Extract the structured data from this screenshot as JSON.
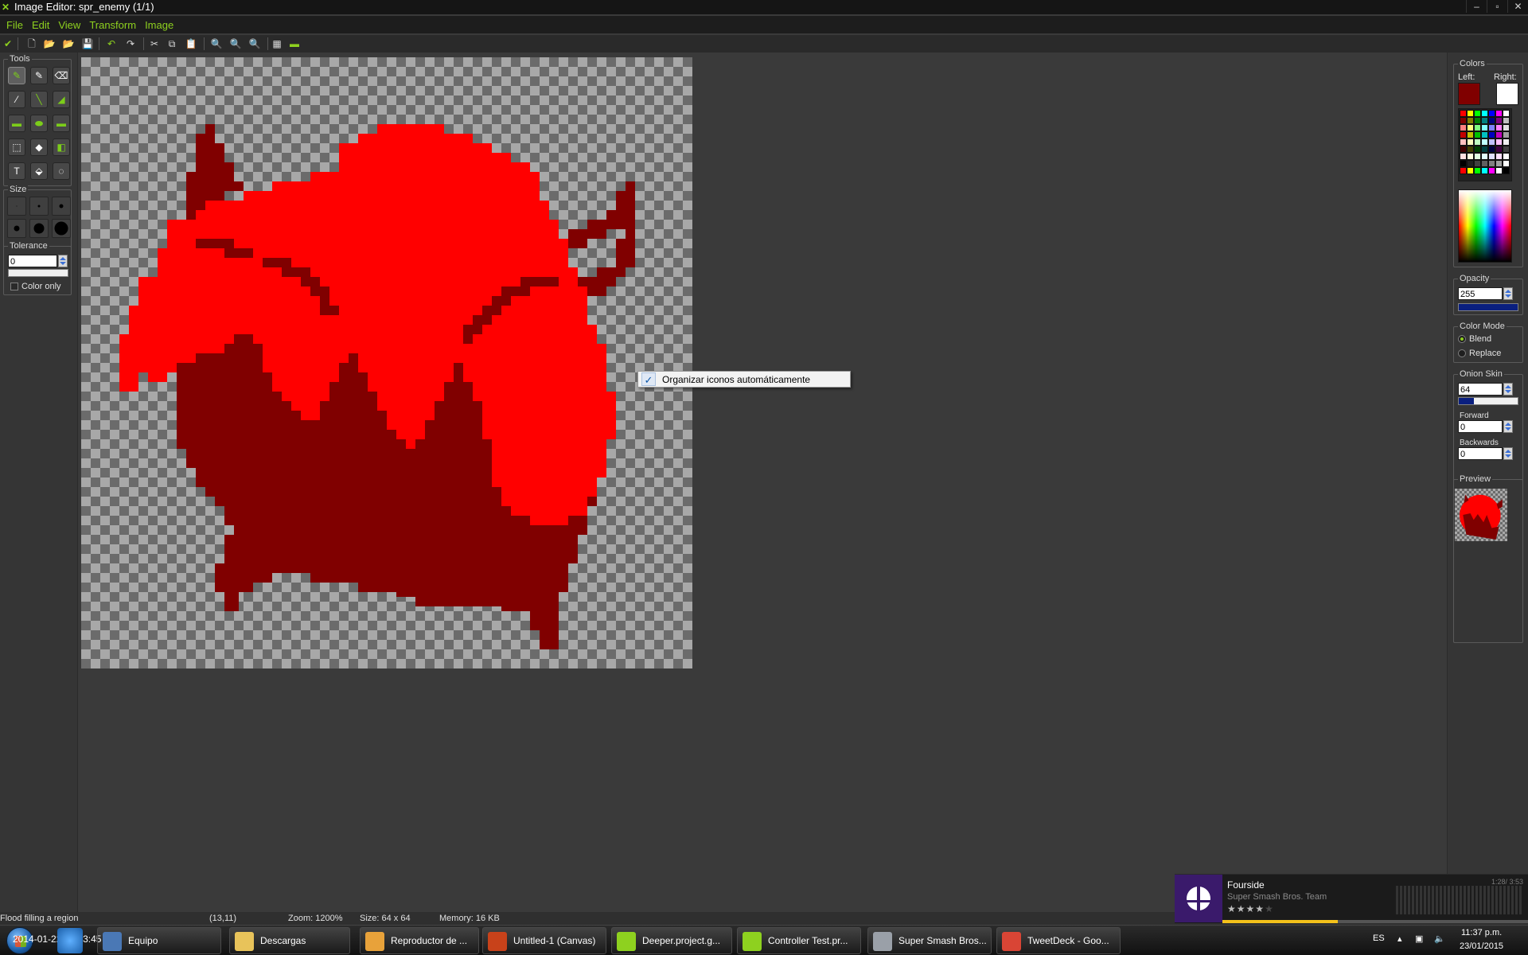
{
  "window": {
    "title": "Image Editor: spr_enemy (1/1)",
    "controls": [
      "–",
      "▫",
      "✕"
    ]
  },
  "menu": [
    "File",
    "Edit",
    "View",
    "Transform",
    "Image"
  ],
  "toolbar": {
    "icons": [
      "confirm-icon",
      "new-file-icon",
      "open-icon",
      "import-icon",
      "save-icon",
      "undo-icon",
      "redo-icon",
      "cut-icon",
      "copy-icon",
      "paste-icon",
      "zoom-out-icon",
      "zoom-reset-icon",
      "zoom-in-icon",
      "grid-icon",
      "preview-toggle-icon"
    ]
  },
  "tools_panel": {
    "tools_title": "Tools",
    "size_title": "Size",
    "tolerance_title": "Tolerance",
    "tolerance_value": "0",
    "color_only_label": "Color only"
  },
  "canvas": {
    "background_dark": "#6b6b6b",
    "background_light": "#a8a8a8",
    "colors": {
      "bright_red": "#ff0000",
      "dark_red": "#800000"
    }
  },
  "context_menu": {
    "item_label": "Organizar iconos automáticamente",
    "checked": true
  },
  "colors_panel": {
    "title": "Colors",
    "left_label": "Left:",
    "right_label": "Right:",
    "left_color": "#800000",
    "right_color": "#ffffff",
    "palette": [
      "#ff0000",
      "#ffff00",
      "#00ff00",
      "#00ffff",
      "#0000ff",
      "#ff00ff",
      "#ffffff",
      "#800000",
      "#808000",
      "#008000",
      "#008080",
      "#000080",
      "#800080",
      "#c0c0c0",
      "#ff8080",
      "#ffff80",
      "#80ff80",
      "#80ffff",
      "#8080ff",
      "#ff80ff",
      "#e0e0e0",
      "#c00000",
      "#c0c000",
      "#00c000",
      "#00c0c0",
      "#0000c0",
      "#c000c0",
      "#a0a0a0",
      "#ffc0c0",
      "#ffffc0",
      "#c0ffc0",
      "#c0ffff",
      "#c0c0ff",
      "#ffc0ff",
      "#f0f0f0",
      "#400000",
      "#404000",
      "#004000",
      "#004040",
      "#000040",
      "#400040",
      "#404040",
      "#ffe0e0",
      "#ffffe0",
      "#e0ffe0",
      "#e0ffff",
      "#e0e0ff",
      "#ffe0ff",
      "#ffffff",
      "#000000",
      "#202020",
      "#404040",
      "#606060",
      "#808080",
      "#a0a0a0",
      "#ffffff",
      "#ff0000",
      "#ffff00",
      "#00ff00",
      "#00ffff",
      "#ff00ff",
      "#ffffff",
      "#000000"
    ]
  },
  "opacity": {
    "title": "Opacity",
    "value": "255",
    "level": 1.0
  },
  "color_mode": {
    "title": "Color Mode",
    "options": [
      "Blend",
      "Replace"
    ],
    "selected": "Blend"
  },
  "onion_skin": {
    "title": "Onion Skin",
    "value": "64",
    "level": 0.25,
    "forward_label": "Forward",
    "forward_value": "0",
    "backwards_label": "Backwards",
    "backwards_value": "0"
  },
  "preview": {
    "title": "Preview"
  },
  "status": {
    "message": "Flood filling a region",
    "coords": "(13,11)",
    "zoom": "Zoom: 1200%",
    "size": "Size: 64 x 64",
    "memory": "Memory: 16 KB"
  },
  "music": {
    "title": "Fourside",
    "artist": "Super Smash Bros. Team",
    "stars": "★★★★★",
    "rating": 4,
    "time": "1:28/ 3:53",
    "progress": 0.377
  },
  "taskbar": {
    "overlay_text": "2014-01-22 07:03:45",
    "items": [
      {
        "label": "Equipo",
        "icon": "computer-icon",
        "color": "#4a78b5"
      },
      {
        "label": "Descargas",
        "icon": "folder-icon",
        "color": "#e8c35a"
      },
      {
        "label": "Reproductor de ...",
        "icon": "media-player-icon",
        "color": "#e8a23a"
      },
      {
        "label": "Untitled-1 (Canvas)",
        "icon": "flash-icon",
        "color": "#c8421a"
      },
      {
        "label": "Deeper.project.g...",
        "icon": "gamemaker-icon",
        "color": "#8ed11f"
      },
      {
        "label": "Controller Test.pr...",
        "icon": "gamemaker-icon",
        "color": "#8ed11f"
      },
      {
        "label": "Super Smash Bros...",
        "icon": "winamp-icon",
        "color": "#9aa0a8"
      },
      {
        "label": "TweetDeck - Goo...",
        "icon": "chrome-icon",
        "color": "#d94535"
      }
    ],
    "lang": "ES",
    "time": "11:37 p.m.",
    "date": "23/01/2015"
  }
}
